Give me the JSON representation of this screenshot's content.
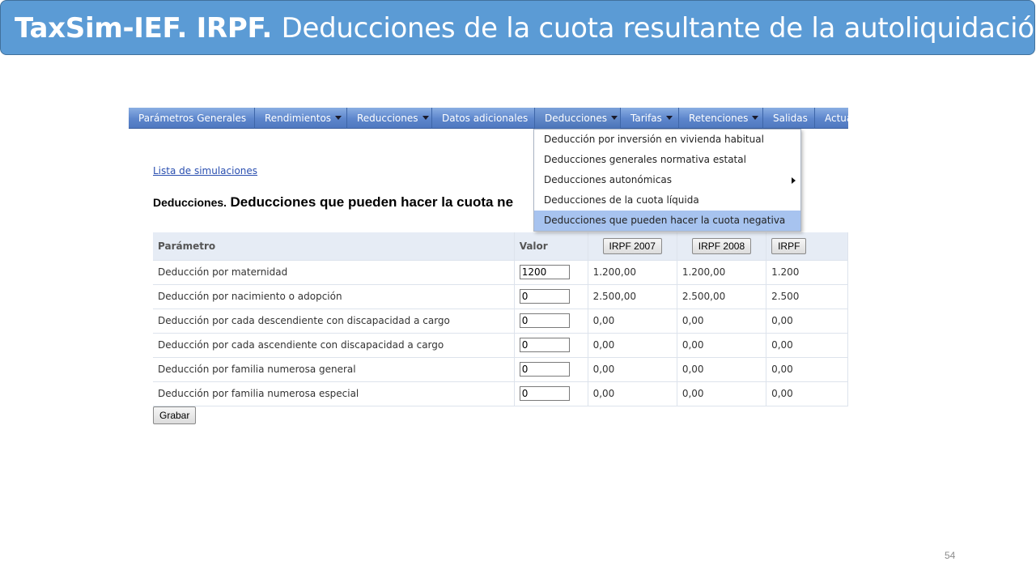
{
  "slide": {
    "title_bold": "TaxSim-IEF. IRPF.",
    "title_rest": "Deducciones de la cuota resultante de la autoliquidación",
    "page_number": "54",
    "banner_color": "#5b9bd5"
  },
  "menu": {
    "items": [
      {
        "label": "Parámetros Generales",
        "has_arrow": false
      },
      {
        "label": "Rendimientos",
        "has_arrow": true
      },
      {
        "label": "Reducciones",
        "has_arrow": true
      },
      {
        "label": "Datos adicionales",
        "has_arrow": false
      },
      {
        "label": "Deducciones",
        "has_arrow": true
      },
      {
        "label": "Tarifas",
        "has_arrow": true
      },
      {
        "label": "Retenciones",
        "has_arrow": true
      },
      {
        "label": "Salidas",
        "has_arrow": false
      },
      {
        "label": "Actua",
        "has_arrow": false
      }
    ],
    "open_item": "Deducciones"
  },
  "dropdown": {
    "items": [
      {
        "label": "Deducción por inversión en vivienda habitual",
        "submenu": false,
        "active": false
      },
      {
        "label": "Deducciones generales normativa estatal",
        "submenu": false,
        "active": false
      },
      {
        "label": "Deducciones autonómicas",
        "submenu": true,
        "active": false
      },
      {
        "label": "Deducciones de la cuota líquida",
        "submenu": false,
        "active": false
      },
      {
        "label": "Deducciones que pueden hacer la cuota negativa",
        "submenu": false,
        "active": true
      }
    ]
  },
  "page": {
    "link_label": "Lista de simulaciones",
    "heading_small": "Deducciones.",
    "heading_large": "Deducciones que pueden hacer la cuota ne",
    "save_label": "Grabar"
  },
  "table": {
    "header_param": "Parámetro",
    "header_valor": "Valor",
    "year_buttons": [
      "IRPF 2007",
      "IRPF 2008",
      "IRPF"
    ],
    "rows": [
      {
        "param": "Deducción por maternidad",
        "input": "1200",
        "y2007": "1.200,00",
        "y2008": "1.200,00",
        "y2009": "1.200"
      },
      {
        "param": "Deducción por nacimiento o adopción",
        "input": "0",
        "y2007": "2.500,00",
        "y2008": "2.500,00",
        "y2009": "2.500"
      },
      {
        "param": "Deducción por cada descendiente con discapacidad a cargo",
        "input": "0",
        "y2007": "0,00",
        "y2008": "0,00",
        "y2009": "0,00"
      },
      {
        "param": "Deducción por cada ascendiente con discapacidad a cargo",
        "input": "0",
        "y2007": "0,00",
        "y2008": "0,00",
        "y2009": "0,00"
      },
      {
        "param": "Deducción por familia numerosa general",
        "input": "0",
        "y2007": "0,00",
        "y2008": "0,00",
        "y2009": "0,00"
      },
      {
        "param": "Deducción por familia numerosa especial",
        "input": "0",
        "y2007": "0,00",
        "y2008": "0,00",
        "y2009": "0,00"
      }
    ]
  }
}
